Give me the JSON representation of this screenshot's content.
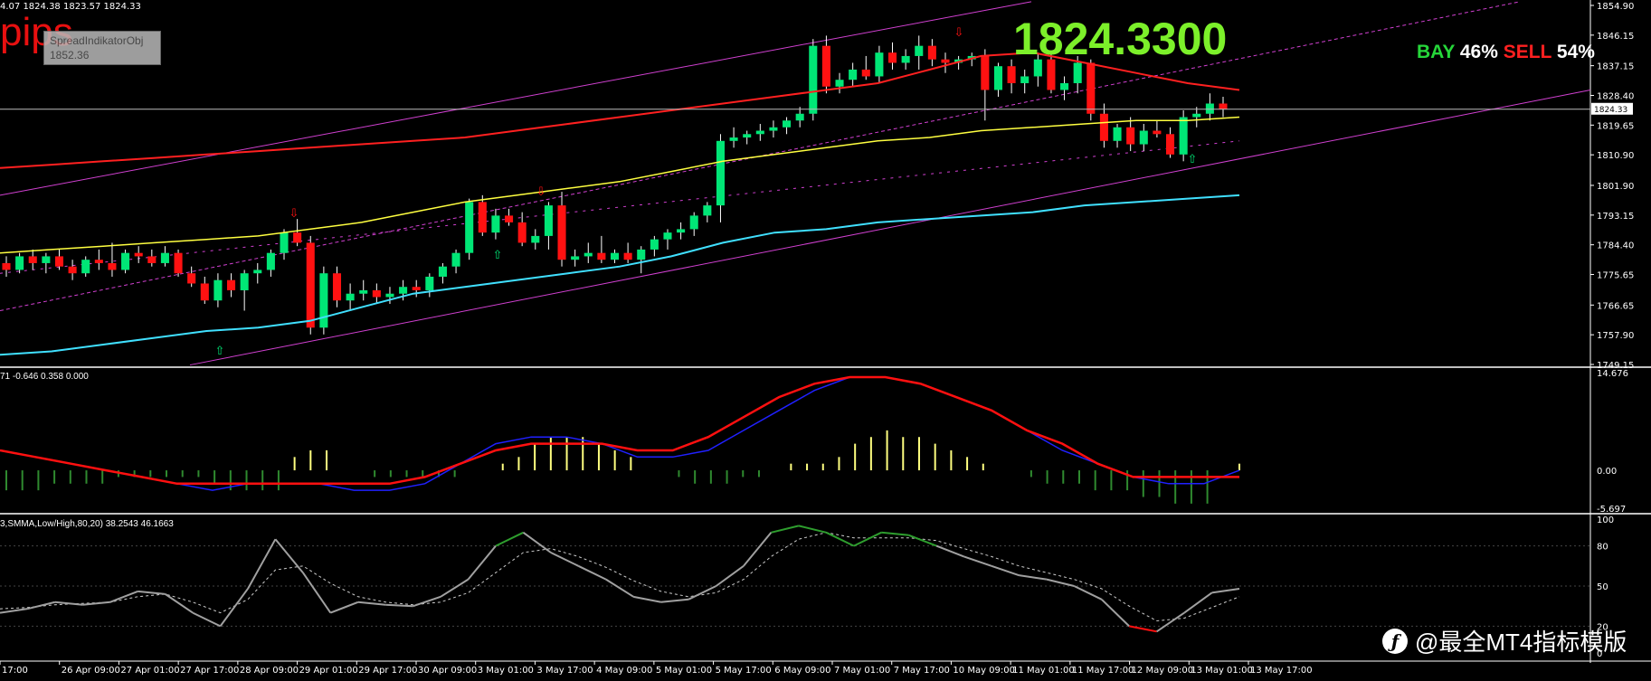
{
  "header": {
    "ohlc_text": "4.07 1824.38 1823.57 1824.33",
    "pips_text": "pips",
    "spread_object_name": "SpreadIndikatorObj",
    "spread_object_value": "1852.36",
    "big_price": "1824.3300",
    "bay_label": "BAY",
    "bay_pct": "46%",
    "sell_label": "SELL",
    "sell_pct": "54%"
  },
  "current_price_tag": "1824.33",
  "macd_label": "71 -0.646 0.358 0.000",
  "stoch_label": "3,SMMA,Low/High,80,20) 38.2543 46.1663",
  "watermark": "@最全MT4指标模版",
  "colors": {
    "bull": "#00e676",
    "bear": "#ff1111",
    "upper_band": "#ff2020",
    "mid_ma": "#ffff40",
    "lower_band": "#40e0ff",
    "channel": "#d040d0",
    "macd_main": "#2020ff",
    "macd_signal": "#ff1010",
    "hist_pos": "#ffff80",
    "hist_neg": "#2f8a2f",
    "stoch_main": "#a0a0a0",
    "stoch_sig": "#cccccc"
  },
  "chart_data": [
    {
      "type": "candlestick",
      "title": "",
      "ylim": [
        1749.15,
        1854.9
      ],
      "y_ticks": [
        "1854.90",
        "1846.15",
        "1837.15",
        "1828.40",
        "1819.65",
        "1810.90",
        "1801.90",
        "1793.15",
        "1784.40",
        "1775.65",
        "1766.65",
        "1757.90",
        "1749.15"
      ],
      "x_ticks": [
        "17:00",
        "26 Apr 09:00",
        "27 Apr 01:00",
        "27 Apr 17:00",
        "28 Apr 09:00",
        "29 Apr 01:00",
        "29 Apr 17:00",
        "30 Apr 09:00",
        "3 May 01:00",
        "3 May 17:00",
        "4 May 09:00",
        "5 May 01:00",
        "5 May 17:00",
        "6 May 09:00",
        "7 May 01:00",
        "7 May 17:00",
        "10 May 09:00",
        "11 May 01:00",
        "11 May 17:00",
        "12 May 09:00",
        "13 May 01:00",
        "13 May 17:00"
      ],
      "candles": [
        [
          1779,
          1781,
          1775,
          1777
        ],
        [
          1777,
          1782,
          1776,
          1781
        ],
        [
          1781,
          1783,
          1777,
          1779
        ],
        [
          1779,
          1782,
          1776,
          1781
        ],
        [
          1781,
          1783,
          1777,
          1778
        ],
        [
          1778,
          1780,
          1774,
          1776
        ],
        [
          1776,
          1781,
          1775,
          1780
        ],
        [
          1780,
          1783,
          1777,
          1779
        ],
        [
          1779,
          1785,
          1775,
          1777
        ],
        [
          1777,
          1783,
          1776,
          1782
        ],
        [
          1782,
          1784,
          1779,
          1781
        ],
        [
          1781,
          1783,
          1778,
          1779
        ],
        [
          1779,
          1784,
          1778,
          1782
        ],
        [
          1782,
          1783,
          1775,
          1776
        ],
        [
          1776,
          1778,
          1772,
          1773
        ],
        [
          1773,
          1775,
          1767,
          1768
        ],
        [
          1768,
          1776,
          1766,
          1774
        ],
        [
          1774,
          1776,
          1769,
          1771
        ],
        [
          1771,
          1777,
          1765,
          1776
        ],
        [
          1776,
          1779,
          1773,
          1777
        ],
        [
          1777,
          1783,
          1775,
          1782
        ],
        [
          1782,
          1789,
          1780,
          1788
        ],
        [
          1788,
          1792,
          1784,
          1785
        ],
        [
          1785,
          1787,
          1758,
          1760
        ],
        [
          1760,
          1778,
          1758,
          1776
        ],
        [
          1776,
          1778,
          1766,
          1768
        ],
        [
          1768,
          1773,
          1765,
          1770
        ],
        [
          1770,
          1774,
          1768,
          1771
        ],
        [
          1771,
          1773,
          1767,
          1769
        ],
        [
          1769,
          1772,
          1767,
          1770
        ],
        [
          1770,
          1774,
          1768,
          1772
        ],
        [
          1772,
          1774,
          1769,
          1771
        ],
        [
          1771,
          1776,
          1769,
          1775
        ],
        [
          1775,
          1779,
          1773,
          1778
        ],
        [
          1778,
          1783,
          1776,
          1782
        ],
        [
          1782,
          1798,
          1780,
          1797
        ],
        [
          1797,
          1799,
          1787,
          1788
        ],
        [
          1788,
          1795,
          1786,
          1793
        ],
        [
          1793,
          1795,
          1790,
          1791
        ],
        [
          1791,
          1794,
          1784,
          1785
        ],
        [
          1785,
          1789,
          1783,
          1787
        ],
        [
          1787,
          1797,
          1783,
          1796
        ],
        [
          1796,
          1800,
          1778,
          1780
        ],
        [
          1780,
          1783,
          1778,
          1781
        ],
        [
          1781,
          1785,
          1779,
          1782
        ],
        [
          1782,
          1787,
          1779,
          1780
        ],
        [
          1780,
          1783,
          1779,
          1782
        ],
        [
          1782,
          1785,
          1779,
          1780
        ],
        [
          1780,
          1784,
          1776,
          1783
        ],
        [
          1783,
          1787,
          1781,
          1786
        ],
        [
          1786,
          1789,
          1783,
          1788
        ],
        [
          1788,
          1791,
          1786,
          1789
        ],
        [
          1789,
          1794,
          1787,
          1793
        ],
        [
          1793,
          1797,
          1791,
          1796
        ],
        [
          1796,
          1817,
          1791,
          1815
        ],
        [
          1815,
          1819,
          1813,
          1816
        ],
        [
          1816,
          1818,
          1814,
          1817
        ],
        [
          1817,
          1820,
          1815,
          1818
        ],
        [
          1818,
          1821,
          1816,
          1819
        ],
        [
          1819,
          1822,
          1817,
          1821
        ],
        [
          1821,
          1825,
          1819,
          1823
        ],
        [
          1823,
          1845,
          1821,
          1843
        ],
        [
          1843,
          1846,
          1829,
          1831
        ],
        [
          1831,
          1835,
          1829,
          1833
        ],
        [
          1833,
          1838,
          1831,
          1836
        ],
        [
          1836,
          1840,
          1833,
          1834
        ],
        [
          1834,
          1843,
          1832,
          1841
        ],
        [
          1841,
          1844,
          1836,
          1838
        ],
        [
          1838,
          1842,
          1836,
          1840
        ],
        [
          1840,
          1846,
          1836,
          1843
        ],
        [
          1843,
          1845,
          1837,
          1839
        ],
        [
          1839,
          1841,
          1835,
          1838
        ],
        [
          1838,
          1840,
          1836,
          1839
        ],
        [
          1839,
          1841,
          1837,
          1840
        ],
        [
          1840,
          1842,
          1821,
          1830
        ],
        [
          1830,
          1838,
          1828,
          1837
        ],
        [
          1837,
          1839,
          1829,
          1832
        ],
        [
          1832,
          1836,
          1829,
          1834
        ],
        [
          1834,
          1841,
          1831,
          1839
        ],
        [
          1839,
          1841,
          1829,
          1830
        ],
        [
          1830,
          1834,
          1827,
          1832
        ],
        [
          1832,
          1840,
          1829,
          1838
        ],
        [
          1838,
          1839,
          1821,
          1823
        ],
        [
          1823,
          1826,
          1813,
          1815
        ],
        [
          1815,
          1820,
          1813,
          1819
        ],
        [
          1819,
          1822,
          1812,
          1814
        ],
        [
          1814,
          1820,
          1812,
          1818
        ],
        [
          1818,
          1821,
          1816,
          1817
        ],
        [
          1817,
          1819,
          1810,
          1811
        ],
        [
          1811,
          1824,
          1809,
          1822
        ],
        [
          1822,
          1825,
          1819,
          1823
        ],
        [
          1823,
          1829,
          1821,
          1826
        ],
        [
          1826,
          1828,
          1822,
          1824.33
        ]
      ],
      "upper_band": [
        1807,
        1808,
        1809,
        1810,
        1811,
        1812,
        1813,
        1814,
        1815,
        1816,
        1818,
        1820,
        1822,
        1824,
        1826,
        1828,
        1830,
        1832,
        1836,
        1840,
        1841,
        1838,
        1835,
        1832,
        1830
      ],
      "mid_ma": [
        1782,
        1783,
        1784,
        1785,
        1786,
        1787,
        1789,
        1791,
        1794,
        1797,
        1799,
        1801,
        1803,
        1806,
        1809,
        1811,
        1813,
        1815,
        1816,
        1818,
        1819,
        1820,
        1821,
        1821,
        1822
      ],
      "lower_band": [
        1752,
        1753,
        1755,
        1757,
        1759,
        1760,
        1762,
        1766,
        1770,
        1772,
        1774,
        1776,
        1778,
        1781,
        1785,
        1788,
        1789,
        1791,
        1792,
        1793,
        1794,
        1796,
        1797,
        1798,
        1799
      ]
    },
    {
      "type": "macd",
      "ylim": [
        -5.697,
        14.676
      ],
      "y_ticks": [
        "14.676",
        "0.00",
        "-5.697"
      ],
      "histogram": [
        -3,
        -3,
        -3,
        -2,
        -2,
        -2,
        -2,
        -1,
        -1,
        -1,
        -1,
        -1,
        -1,
        -2,
        -3,
        -3,
        -3,
        -3,
        2,
        3,
        3,
        0,
        0,
        -1,
        -1,
        -1,
        -1,
        -1,
        -1,
        0,
        0,
        1,
        2,
        4,
        5,
        5,
        5,
        4,
        3,
        2,
        0,
        0,
        -1,
        -2,
        -2,
        -2,
        -1,
        -1,
        0,
        1,
        1,
        1,
        2,
        4,
        5,
        6,
        5,
        5,
        4,
        3,
        2,
        1,
        0,
        0,
        -1,
        -2,
        -2,
        -2,
        -3,
        -3,
        -3,
        -4,
        -4,
        -5,
        -5,
        -5,
        0,
        1
      ],
      "macd_main": [
        3,
        2,
        1,
        0,
        -1,
        -2,
        -3,
        -2,
        -2,
        -2,
        -3,
        -3,
        -2,
        1,
        4,
        5,
        5,
        4,
        2,
        2,
        3,
        6,
        9,
        12,
        14,
        14,
        13,
        11,
        9,
        6,
        3,
        1,
        -1,
        -2,
        -2,
        0
      ],
      "macd_signal": [
        3,
        2,
        1,
        0,
        -1,
        -2,
        -2,
        -2,
        -2,
        -2,
        -2,
        -2,
        -1,
        1,
        3,
        4,
        4,
        4,
        3,
        3,
        5,
        8,
        11,
        13,
        14,
        14,
        13,
        11,
        9,
        6,
        4,
        1,
        -1,
        -1,
        -1,
        -1
      ]
    },
    {
      "type": "stochastic",
      "ylim": [
        0,
        100
      ],
      "y_ticks": [
        "100",
        "80",
        "50",
        "20",
        "0"
      ],
      "main": [
        30,
        33,
        38,
        36,
        38,
        46,
        44,
        30,
        20,
        48,
        85,
        60,
        30,
        38,
        36,
        35,
        42,
        55,
        80,
        90,
        75,
        65,
        55,
        42,
        38,
        40,
        50,
        65,
        90,
        95,
        90,
        80,
        90,
        88,
        80,
        72,
        65,
        58,
        55,
        50,
        40,
        20,
        16,
        30,
        45,
        48
      ],
      "signal": [
        33,
        34,
        36,
        37,
        38,
        42,
        44,
        38,
        30,
        40,
        62,
        65,
        52,
        42,
        38,
        36,
        38,
        45,
        60,
        75,
        78,
        72,
        64,
        54,
        46,
        42,
        45,
        55,
        72,
        85,
        90,
        86,
        86,
        86,
        84,
        78,
        72,
        65,
        60,
        55,
        48,
        35,
        24,
        26,
        34,
        42
      ]
    }
  ]
}
